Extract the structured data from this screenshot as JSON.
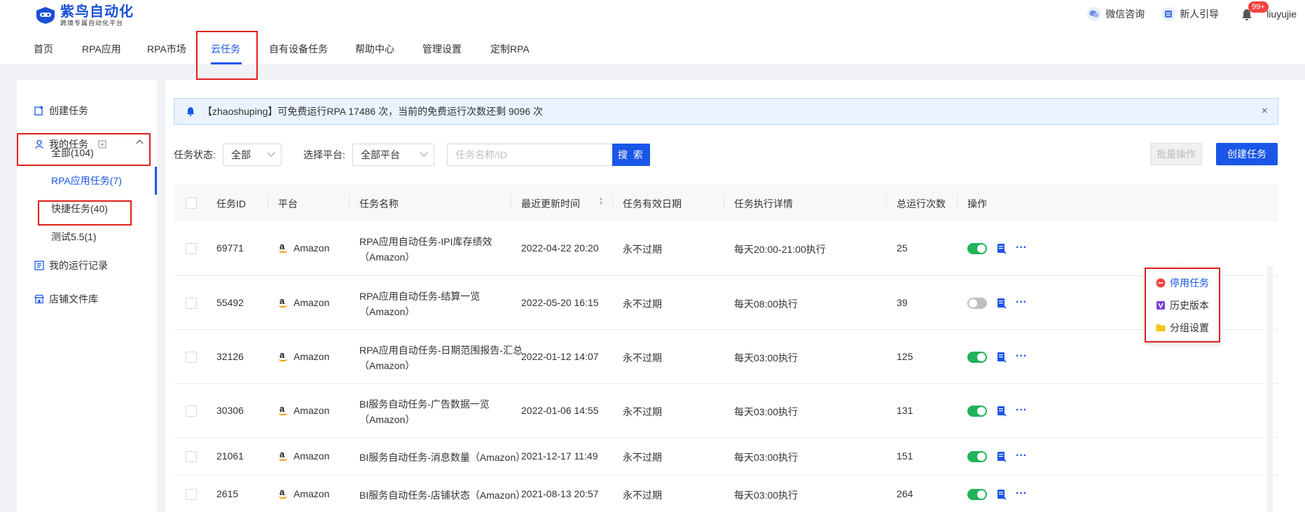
{
  "brand": {
    "name": "紫鸟自动化",
    "tagline": "跨境专属自动化平台"
  },
  "header": {
    "links": [
      "微信咨询",
      "新人引导"
    ],
    "badge": "99+",
    "username": "liuyujie"
  },
  "nav": [
    "首页",
    "RPA应用",
    "RPA市场",
    "云任务",
    "自有设备任务",
    "帮助中心",
    "管理设置",
    "定制RPA"
  ],
  "sidebar": {
    "create": "创建任务",
    "my_tasks": "我的任务",
    "sub": [
      "全部(104)",
      "RPA应用任务(7)",
      "快捷任务(40)",
      "测试5.5(1)"
    ],
    "records": "我的运行记录",
    "files": "店铺文件库"
  },
  "notice": {
    "text": "【zhaoshuping】可免费运行RPA 17486 次，当前的免费运行次数还剩 9096 次",
    "close": "×"
  },
  "filters": {
    "status_label": "任务状态:",
    "status_value": "全部",
    "platform_label": "选择平台:",
    "platform_value": "全部平台",
    "search_placeholder": "任务名称/ID",
    "search_btn": "搜 索",
    "batch_btn": "批量操作",
    "create_btn": "创建任务"
  },
  "table": {
    "headers": [
      "任务ID",
      "平台",
      "任务名称",
      "最近更新时间",
      "任务有效日期",
      "任务执行详情",
      "总运行次数",
      "操作"
    ],
    "rows": [
      {
        "id": "69771",
        "platform": "Amazon",
        "name1": "RPA应用自动任务-IPI库存绩效",
        "name2": "（Amazon）",
        "updated": "2022-04-22 20:20",
        "validity": "永不过期",
        "detail": "每天20:00-21:00执行",
        "runs": "25",
        "on": true
      },
      {
        "id": "55492",
        "platform": "Amazon",
        "name1": "RPA应用自动任务-结算一览",
        "name2": "（Amazon）",
        "updated": "2022-05-20 16:15",
        "validity": "永不过期",
        "detail": "每天08:00执行",
        "runs": "39",
        "on": false
      },
      {
        "id": "32126",
        "platform": "Amazon",
        "name1": "RPA应用自动任务-日期范围报告-汇总",
        "name2": "（Amazon）",
        "updated": "2022-01-12 14:07",
        "validity": "永不过期",
        "detail": "每天03:00执行",
        "runs": "125",
        "on": true
      },
      {
        "id": "30306",
        "platform": "Amazon",
        "name1": "BI服务自动任务-广告数据一览",
        "name2": "（Amazon）",
        "updated": "2022-01-06 14:55",
        "validity": "永不过期",
        "detail": "每天03:00执行",
        "runs": "131",
        "on": true
      },
      {
        "id": "21061",
        "platform": "Amazon",
        "name1": "BI服务自动任务-消息数量（Amazon）",
        "name2": "",
        "updated": "2021-12-17 11:49",
        "validity": "永不过期",
        "detail": "每天03:00执行",
        "runs": "151",
        "on": true
      },
      {
        "id": "2615",
        "platform": "Amazon",
        "name1": "BI服务自动任务-店铺状态（Amazon）",
        "name2": "",
        "updated": "2021-08-13 20:57",
        "validity": "永不过期",
        "detail": "每天03:00执行",
        "runs": "264",
        "on": true
      }
    ]
  },
  "menu": [
    "停用任务",
    "历史版本",
    "分组设置"
  ],
  "colors": {
    "primary": "#1a56e8",
    "success": "#20b359",
    "danger": "#f5413d",
    "highlight": "#e0201a"
  }
}
